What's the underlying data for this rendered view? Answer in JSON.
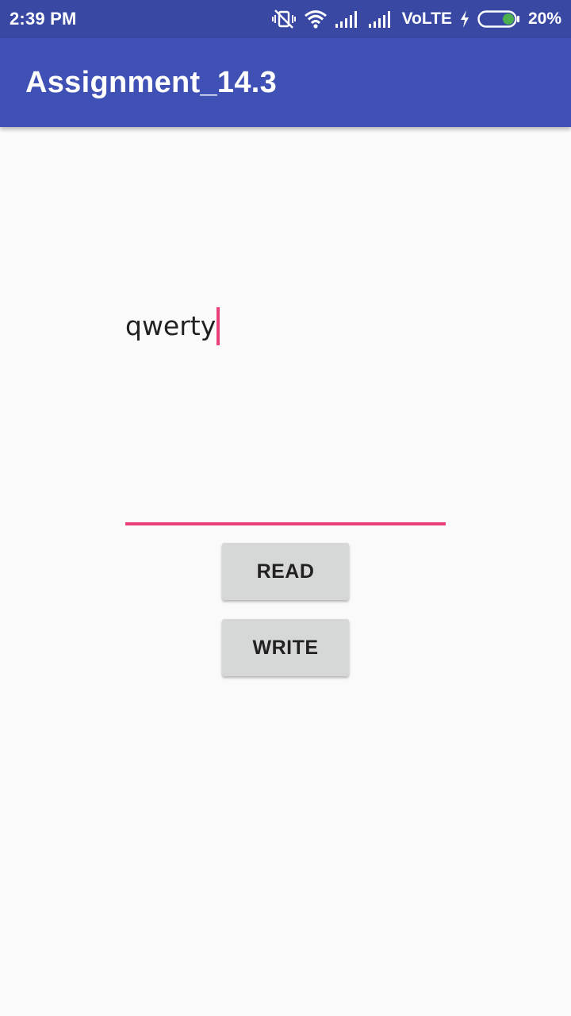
{
  "status_bar": {
    "time": "2:39 PM",
    "network_label": "VoLTE",
    "battery_percent": "20%",
    "battery_level": 0.2,
    "icons": [
      "vibrate-off-icon",
      "wifi-icon",
      "signal-icon",
      "signal-icon",
      "charging-icon",
      "battery-icon"
    ]
  },
  "app_bar": {
    "title": "Assignment_14.3"
  },
  "main": {
    "edit_text_value": "qwerty",
    "read_button_label": "READ",
    "write_button_label": "WRITE"
  },
  "colors": {
    "status_bar": "#3949a3",
    "app_bar": "#3f51b5",
    "accent": "#ec407a",
    "background": "#fafafa",
    "button": "#d6d7d7"
  }
}
